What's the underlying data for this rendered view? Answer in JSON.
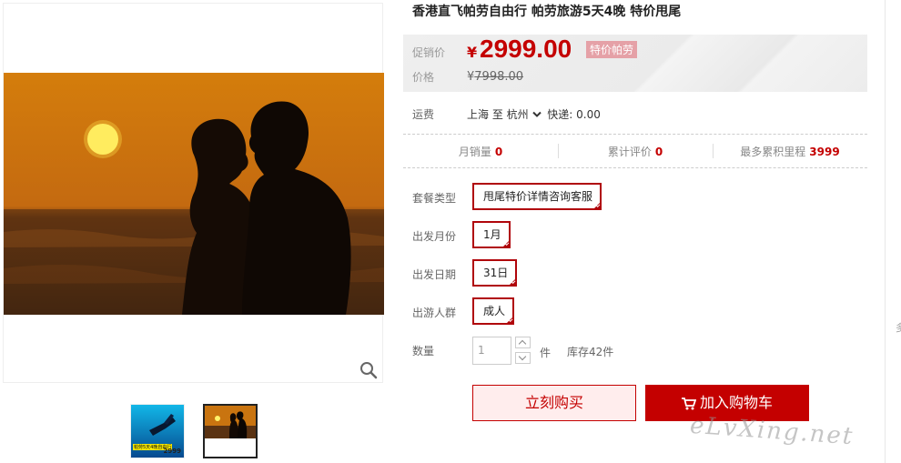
{
  "product": {
    "title": "香港直飞帕劳自由行 帕劳旅游5天4晚 特价甩尾"
  },
  "gallery": {
    "thumbs": [
      {
        "caption": "帕劳5天4晚自由行",
        "price": "2999"
      },
      {
        "caption": "",
        "price": ""
      }
    ],
    "zoom_icon": "magnifier-icon"
  },
  "price": {
    "promo_label": "促销价",
    "currency": "¥",
    "promo_price": "2999.00",
    "badge": "特价帕劳",
    "orig_label": "价格",
    "orig_currency": "¥",
    "orig_price": "7998.00"
  },
  "shipping": {
    "label": "运费",
    "text": "上海 至 杭州",
    "express": "快递: 0.00"
  },
  "stats": [
    {
      "label": "月销量",
      "value": "0"
    },
    {
      "label": "累计评价",
      "value": "0"
    },
    {
      "label": "最多累积里程",
      "value": "3999"
    }
  ],
  "options": {
    "package": {
      "label": "套餐类型",
      "value": "甩尾特价详情咨询客服"
    },
    "month": {
      "label": "出发月份",
      "value": "1月"
    },
    "date": {
      "label": "出发日期",
      "value": "31日"
    },
    "group": {
      "label": "出游人群",
      "value": "成人"
    }
  },
  "quantity": {
    "label": "数量",
    "value": "1",
    "unit": "件",
    "stock": "库存42件"
  },
  "actions": {
    "buy_now": "立刻购买",
    "add_cart": "加入购物车"
  },
  "watermark": "eLvXing.net",
  "edge_char": "多",
  "colors": {
    "accent": "#c40000",
    "option_border": "#b0050b",
    "badge": "#e5a1a7"
  }
}
